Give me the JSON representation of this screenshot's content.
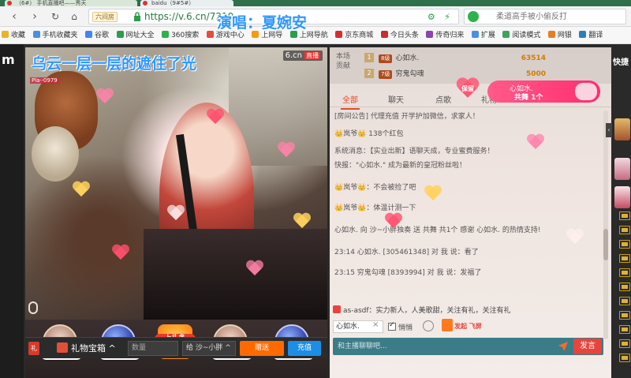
{
  "browser": {
    "tabs": [
      {
        "title": "（6#） 手机直播吧——秀天"
      },
      {
        "title": "baidu（9#5#）"
      }
    ],
    "site_badge": "六间房",
    "url": "https://v.6.cn/7210",
    "search_placeholder": "柔道高手被小偷反打",
    "bookmarks": [
      {
        "label": "收藏",
        "color": "#e8b523"
      },
      {
        "label": "手机收藏夹",
        "color": "#4a90e2"
      },
      {
        "label": "谷歌",
        "color": "#4285f4"
      },
      {
        "label": "网址大全",
        "color": "#2c9d4a"
      },
      {
        "label": "360搜索",
        "color": "#2db34a"
      },
      {
        "label": "游戏中心",
        "color": "#e74c3c"
      },
      {
        "label": "上网导",
        "color": "#f39c12"
      },
      {
        "label": "上网导航",
        "color": "#2c9d4a"
      },
      {
        "label": "京东商城",
        "color": "#d92c2c"
      },
      {
        "label": "今日头条",
        "color": "#cc2b2b"
      },
      {
        "label": "传奇归来",
        "color": "#8e44ad"
      },
      {
        "label": "扩展",
        "color": "#4a90e2"
      },
      {
        "label": "阅读模式",
        "color": "#3fa35a"
      },
      {
        "label": "网银",
        "color": "#e67e22"
      },
      {
        "label": "翻译",
        "color": "#2980b9"
      }
    ]
  },
  "overlay": {
    "singer": "演唱：夏婉安",
    "lyric": "乌云一层一层的遮住了光"
  },
  "video": {
    "logo": "6.cn",
    "live_badge": "直播",
    "tag": "Pla··0979"
  },
  "gift_balls": [
    {
      "name": "👑岚爷👑",
      "style": "face"
    },
    {
      "name": "心如水.",
      "style": "blue"
    },
    {
      "name": "上头条",
      "style": "top"
    },
    {
      "name": "👑岚爷👑",
      "style": "face"
    },
    {
      "name": "心如水.",
      "style": "blue"
    }
  ],
  "gift_toolbar": {
    "badge": "礼",
    "box_label": "礼物宝箱 ^",
    "qty_placeholder": "数量",
    "to_label": "给  沙~小胖 ^",
    "send": "赠送",
    "charge": "充值"
  },
  "rank": {
    "label": "本场贡献",
    "rows": [
      {
        "rank": "1",
        "level": "8级",
        "name": "心如水.",
        "coins": "63514"
      },
      {
        "rank": "2",
        "level": "7级",
        "name": "穷鬼勾魂",
        "coins": "5000"
      }
    ]
  },
  "guard": {
    "badge": "保留",
    "name": "心如水.",
    "count": "共舞 1个"
  },
  "chat_tabs": [
    "全部",
    "聊天",
    "点歌",
    "礼物"
  ],
  "messages": [
    {
      "text": "[房间公告] 代理充值 开学护加微信，求家人！",
      "color": "gray"
    },
    {
      "text": "👑岚爷👑  138个红包",
      "color": "blue"
    },
    {
      "text": "系统消息：【实业出新】语聊天成，专业蜜费服务！",
      "color": "red"
    },
    {
      "text": "快报：\"心如水.\" 成为最新的皇冠粉丝啦！",
      "color": "red"
    },
    {
      "text": "👑岚爷👑：不会被捡了吧",
      "color": "red"
    },
    {
      "text": "👑岚爷👑：体温计测一下",
      "color": "red"
    },
    {
      "text": "心如水. 向 沙~小胖独奏 送 共舞  共1个  感谢 心如水. 的热情支持!",
      "color": "blue"
    },
    {
      "text": "23:14  心如水. [305461348] 对 我 说：看了",
      "color": "gray"
    },
    {
      "text": "23:15  穷鬼勾魂 [8393994] 对 我 说：发福了",
      "color": "gray"
    },
    {
      "text": "as-asdf：实力新人，人美歌甜，关注有礼，关注有礼",
      "color": "gray"
    }
  ],
  "chat_input": {
    "mention": "心如水.",
    "private_label": "悄悄",
    "fly_label": "发起 飞屏",
    "placeholder": "和主播聊聊吧...",
    "send": "发言"
  },
  "right_rail": {
    "quick_label": "快捷"
  }
}
